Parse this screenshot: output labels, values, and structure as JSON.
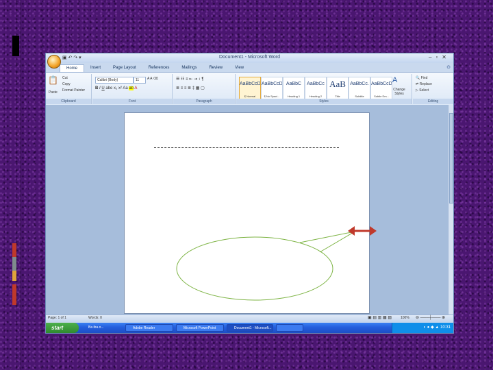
{
  "window": {
    "title": "Document1 - Microsoft Word",
    "qat": "▣ ↶ ↷ ▾"
  },
  "tabs": [
    "Home",
    "Insert",
    "Page Layout",
    "References",
    "Mailings",
    "Review",
    "View"
  ],
  "ribbon": {
    "clipboard": {
      "paste": "Paste",
      "cut": "Cut",
      "copy": "Copy",
      "format_painter": "Format Painter",
      "label": "Clipboard"
    },
    "font": {
      "name": "Calibri (Body)",
      "size": "11",
      "label": "Font"
    },
    "paragraph": {
      "label": "Paragraph"
    },
    "styles": {
      "label": "Styles",
      "items": [
        {
          "sample": "AaBbCcDc",
          "name": "¶ Normal"
        },
        {
          "sample": "AaBbCcDc",
          "name": "¶ No Spaci..."
        },
        {
          "sample": "AaBbC",
          "name": "Heading 1"
        },
        {
          "sample": "AaBbCc",
          "name": "Heading 2"
        },
        {
          "sample": "AaB",
          "name": "Title"
        },
        {
          "sample": "AaBbCc.",
          "name": "Subtitle"
        },
        {
          "sample": "AaBbCcDc",
          "name": "Subtle Em..."
        }
      ],
      "change_styles": "Change Styles"
    },
    "editing": {
      "find": "Find",
      "replace": "Replace",
      "select": "Select",
      "label": "Editing"
    }
  },
  "status": {
    "page": "Page: 1 of 1",
    "words": "Words: 0",
    "zoom": "100%"
  },
  "taskbar": {
    "start": "start",
    "tasks": [
      "Ba ibu.o...",
      "Adobe Reader",
      "Microsoft PowerPoint",
      "Document1 - Microsoft...",
      ""
    ],
    "clock": "10:31"
  },
  "colors": {
    "accent": "#c0392b",
    "callout": "#7cb342",
    "background": "#4a1670"
  }
}
